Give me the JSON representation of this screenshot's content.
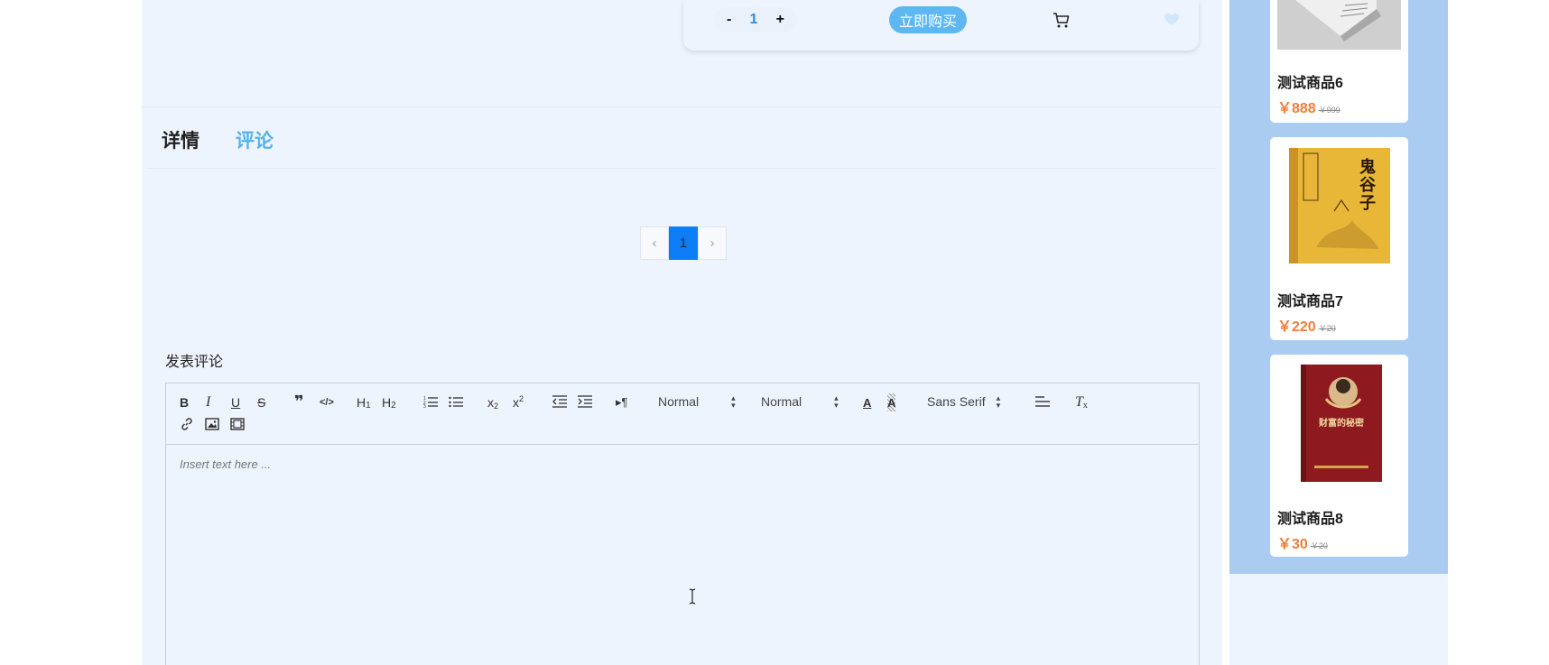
{
  "buy_bar": {
    "qty_minus": "-",
    "qty_value": "1",
    "qty_plus": "+",
    "buy_now": "立即购买",
    "cart_icon": "cart-icon",
    "heart_icon": "heart-icon"
  },
  "tabs": [
    {
      "label": "详情",
      "active": false
    },
    {
      "label": "评论",
      "active": true
    }
  ],
  "pagination": {
    "prev": "‹",
    "current": "1",
    "next": "›"
  },
  "comment": {
    "title": "发表评论",
    "placeholder": "Insert text here ..."
  },
  "toolbar": {
    "header_select": "Normal",
    "size_select": "Normal",
    "font_select": "Sans Serif"
  },
  "products": [
    {
      "name": "测试商品6",
      "price": "￥888",
      "old_price": "￥999"
    },
    {
      "name": "测试商品7",
      "price": "￥220",
      "old_price": "￥20",
      "cover_title": "鬼谷子"
    },
    {
      "name": "测试商品8",
      "price": "￥30",
      "old_price": "￥20",
      "cover_title": "财富的秘密"
    }
  ],
  "colors": {
    "accent": "#5db7f0",
    "price": "#f07d3a",
    "sidebar": "#a9ccf0",
    "page_active": "#0d7df5"
  }
}
